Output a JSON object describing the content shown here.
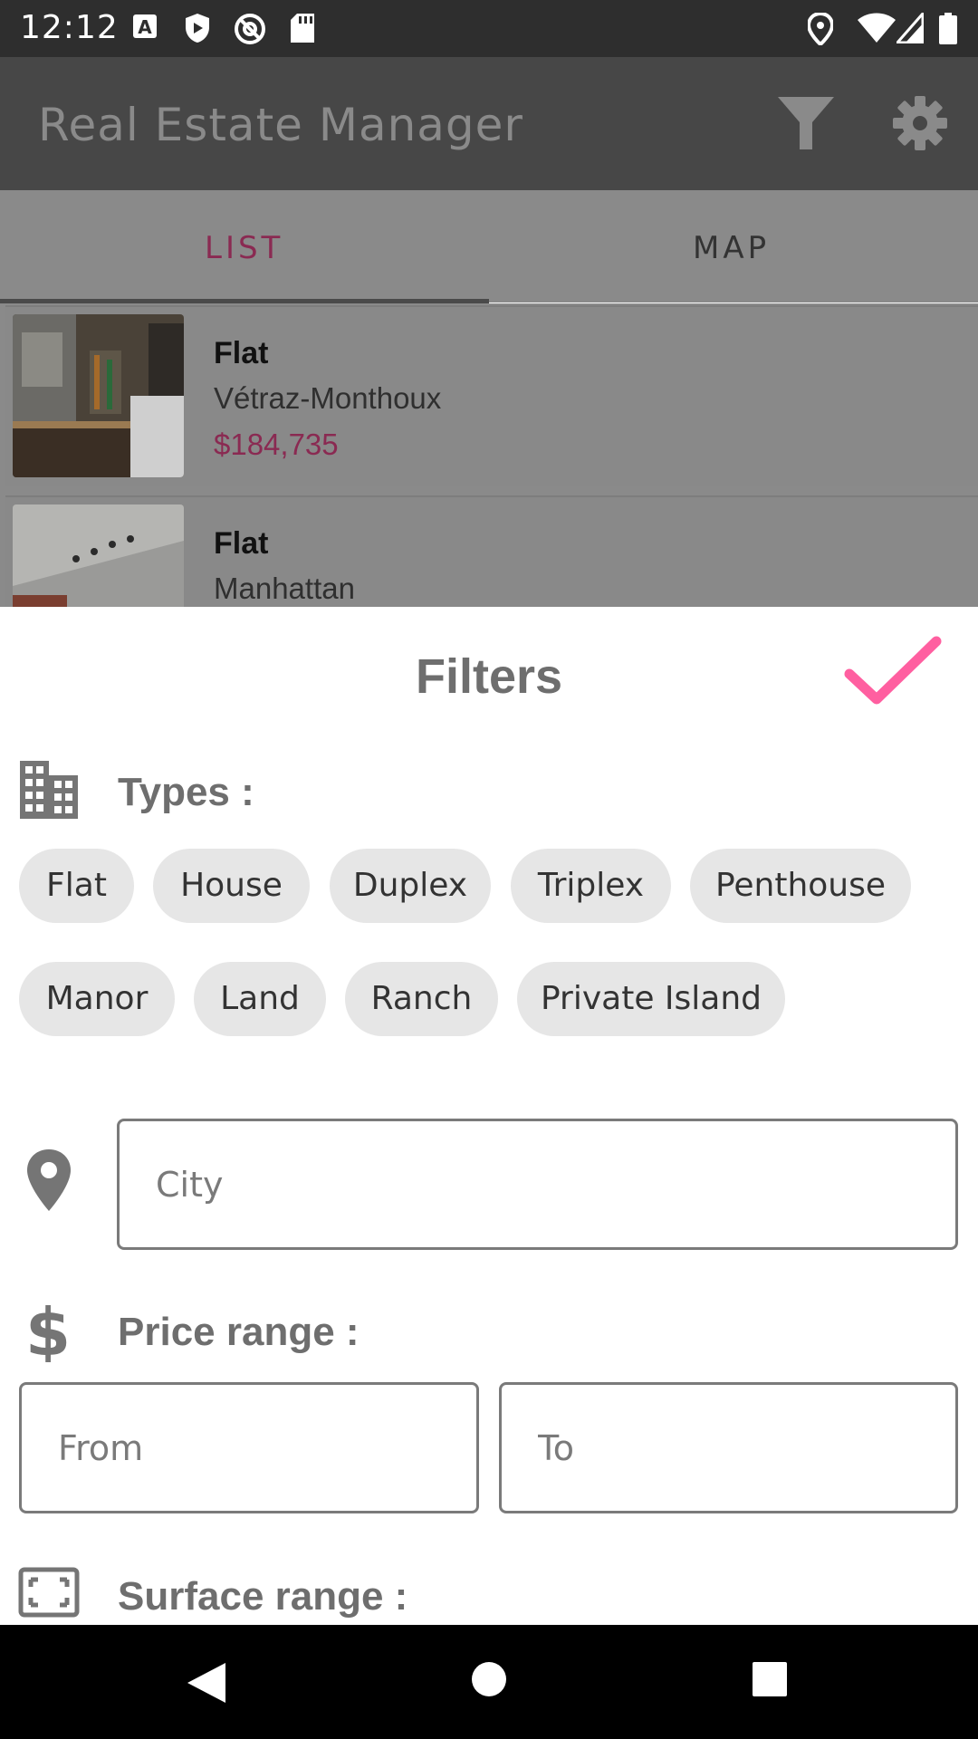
{
  "status_bar": {
    "time": "12:12",
    "icons": [
      "a-notification-icon",
      "shield-icon",
      "at-sign-icon",
      "sd-card-icon",
      "location-icon",
      "wifi-icon",
      "signal-icon",
      "battery-icon"
    ]
  },
  "app_bar": {
    "title": "Real Estate Manager",
    "actions": [
      "filter-icon",
      "settings-icon"
    ]
  },
  "tabs": [
    {
      "label": "LIST",
      "selected": true
    },
    {
      "label": "MAP",
      "selected": false
    }
  ],
  "listings": [
    {
      "type": "Flat",
      "city": "Vétraz-Monthoux",
      "price": "$184,735"
    },
    {
      "type": "Flat",
      "city": "Manhattan",
      "price": ""
    }
  ],
  "filters": {
    "title": "Filters",
    "types_label": "Types :",
    "types": [
      "Flat",
      "House",
      "Duplex",
      "Triplex",
      "Penthouse",
      "Manor",
      "Land",
      "Ranch",
      "Private Island"
    ],
    "city_placeholder": "City",
    "price_label": "Price range :",
    "price_from_placeholder": "From",
    "price_to_placeholder": "To",
    "surface_label": "Surface range :"
  },
  "colors": {
    "accent": "#ff5fa0",
    "price": "#8a2a52",
    "chip_bg": "#e6e6e6"
  }
}
